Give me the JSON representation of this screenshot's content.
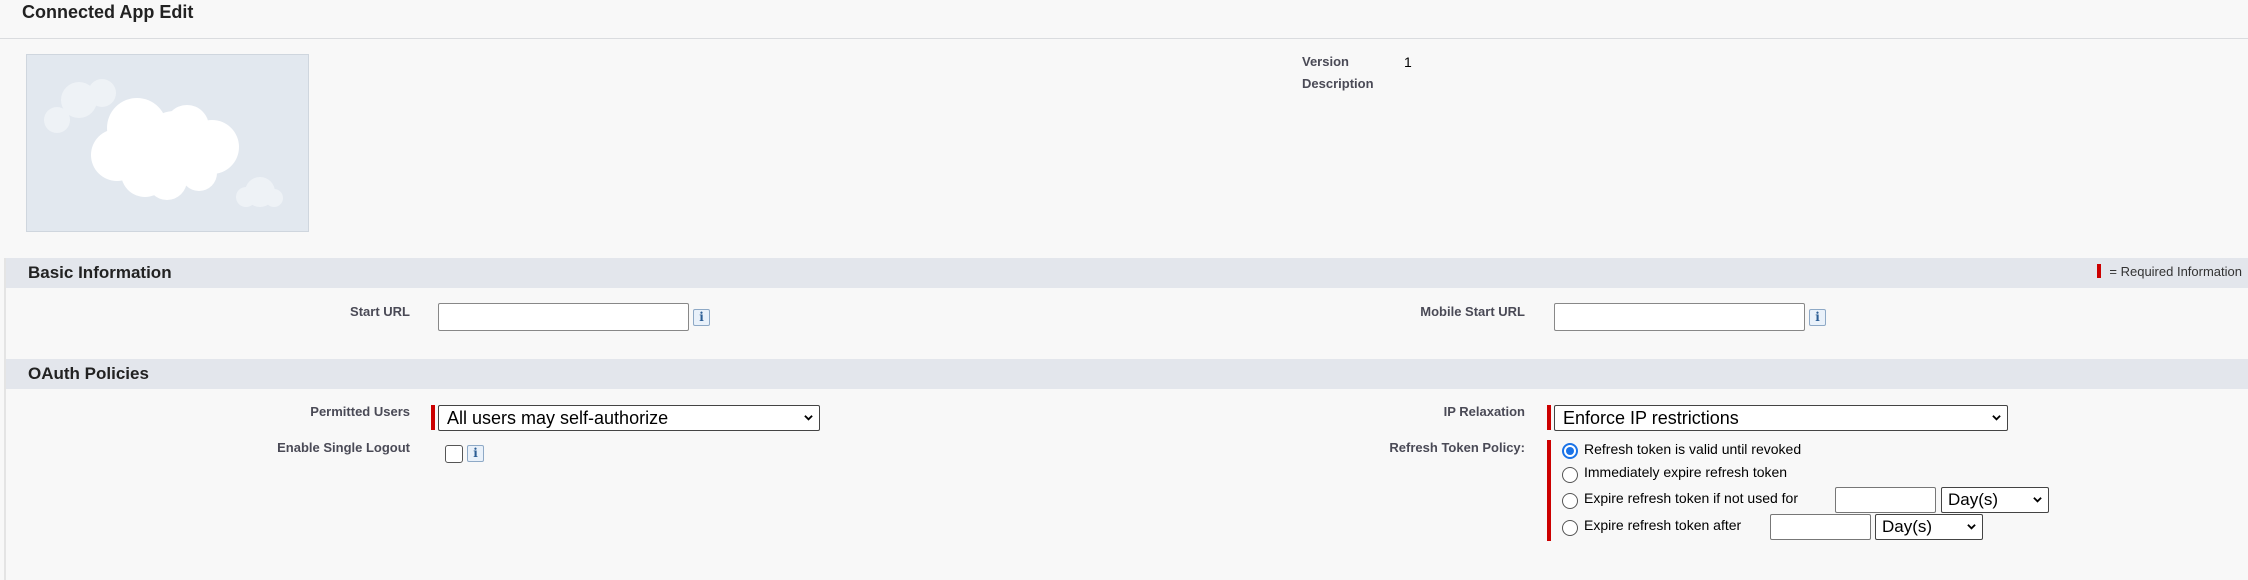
{
  "page": {
    "title": "Connected App Edit"
  },
  "detail": {
    "version_label": "Version",
    "version_value": "1",
    "description_label": "Description"
  },
  "basic_info": {
    "title": "Basic Information",
    "required_legend": "= Required Information",
    "start_url_label": "Start URL",
    "start_url_value": "",
    "mobile_start_url_label": "Mobile Start URL",
    "mobile_start_url_value": "",
    "info_glyph": "i"
  },
  "oauth": {
    "title": "OAuth Policies",
    "permitted_users_label": "Permitted Users",
    "permitted_users_selected": "All users may self-authorize",
    "enable_single_logout_label": "Enable Single Logout",
    "enable_single_logout_checked": false,
    "ip_relaxation_label": "IP Relaxation",
    "ip_relaxation_selected": "Enforce IP restrictions",
    "refresh_token_policy_label": "Refresh Token Policy:",
    "refresh_options": [
      {
        "label": "Refresh token is valid until revoked",
        "checked": true
      },
      {
        "label": "Immediately expire refresh token",
        "checked": false
      },
      {
        "label": "Expire refresh token if not used for",
        "checked": false,
        "unit": "Day(s)"
      },
      {
        "label": "Expire refresh token after",
        "checked": false,
        "unit": "Day(s)"
      }
    ]
  },
  "icons": {
    "logo": "salesforce-cloud-icon",
    "info": "info-icon",
    "dropdown": "chevron-down-icon"
  },
  "colors": {
    "required": "#cc0000",
    "section_bar": "#e3e6ec",
    "radio_selected": "#1a73e8"
  }
}
